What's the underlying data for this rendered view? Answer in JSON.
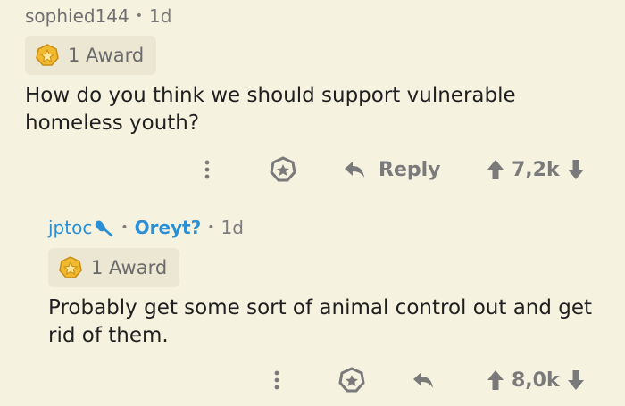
{
  "comments": [
    {
      "username": "sophied144",
      "age": "1d",
      "award_label": "1 Award",
      "body": "How do you think we should support vulnerable homeless youth?",
      "reply_label": "Reply",
      "score": "7,2k"
    },
    {
      "username": "jptoc",
      "flair": "Oreyt?",
      "age": "1d",
      "award_label": "1 Award",
      "body": "Probably get some sort of animal control out and get rid of them.",
      "score": "8,0k"
    }
  ],
  "icons": {
    "more": "more-vertical-icon",
    "award": "award-icon",
    "reply": "reply-arrow-icon",
    "upvote": "upvote-arrow-icon",
    "downvote": "downvote-arrow-icon",
    "mic": "microphone-icon"
  },
  "colors": {
    "background": "#f6f2e0",
    "badge": "#ebe7d3",
    "muted": "#7a7a7a",
    "link_blue": "#2b8fd6"
  }
}
